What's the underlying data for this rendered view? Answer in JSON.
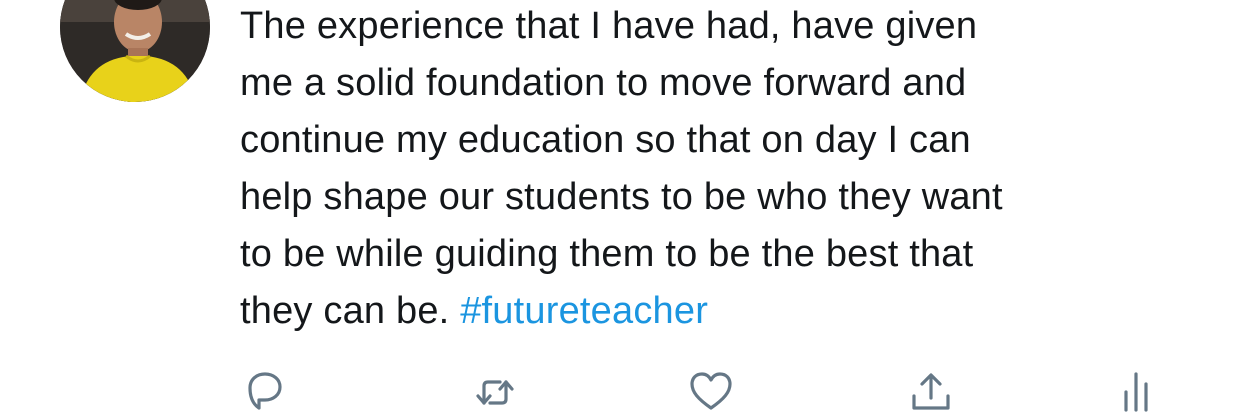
{
  "tweet": {
    "lines": [
      "The experience that I have had, have given",
      "me a solid foundation to move forward and",
      "continue my education so that on day I can",
      "help shape our students to be who they want",
      "to be while guiding them to be the best that",
      "they can be. "
    ],
    "hashtag": "#futureteacher"
  },
  "actions": [
    {
      "name": "reply",
      "icon": "reply-icon"
    },
    {
      "name": "retweet",
      "icon": "retweet-icon"
    },
    {
      "name": "like",
      "icon": "heart-icon"
    },
    {
      "name": "share",
      "icon": "share-icon"
    },
    {
      "name": "analytics",
      "icon": "analytics-icon"
    }
  ],
  "colors": {
    "text": "#14171a",
    "link": "#1b95e0",
    "icon": "#657786",
    "avatar_shirt": "#e8d21a"
  }
}
